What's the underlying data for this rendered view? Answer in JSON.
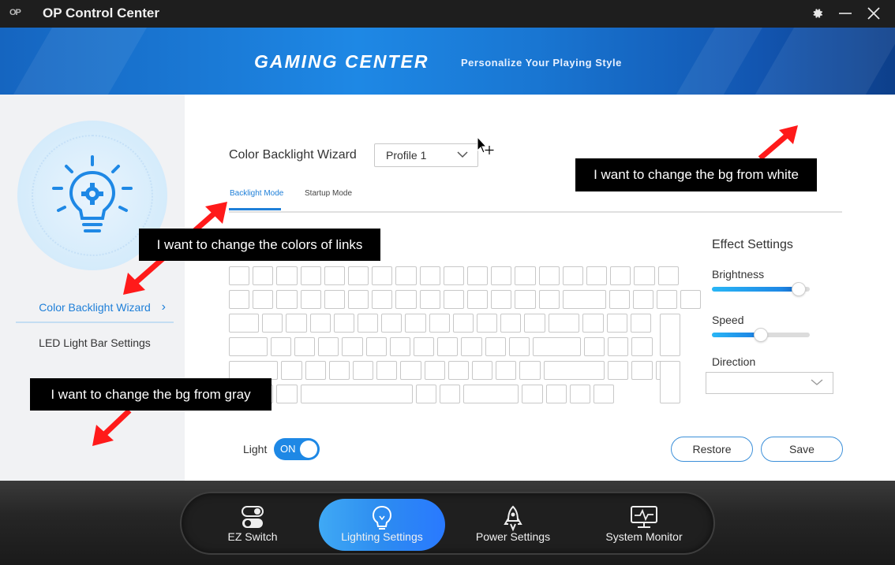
{
  "titlebar": {
    "logo": "OP",
    "title": "OP Control Center"
  },
  "banner": {
    "title": "GAMING CENTER",
    "subtitle": "Personalize Your Playing Style"
  },
  "sidebar": {
    "items": [
      {
        "label": "Color Backlight Wizard",
        "active": true
      },
      {
        "label": "LED Light Bar Settings",
        "active": false
      }
    ]
  },
  "main": {
    "title": "Color Backlight Wizard",
    "profile": {
      "selected": "Profile 1"
    },
    "tabs": [
      {
        "label": "Backlight Mode",
        "active": true
      },
      {
        "label": "Startup Mode",
        "active": false
      }
    ],
    "effect": {
      "title": "Effect Settings",
      "brightness_label": "Brightness",
      "brightness_value": 0.95,
      "speed_label": "Speed",
      "speed_value": 0.5,
      "direction_label": "Direction",
      "direction_value": ""
    },
    "light": {
      "label": "Light",
      "state": "ON"
    },
    "buttons": {
      "restore": "Restore",
      "save": "Save"
    }
  },
  "dock": {
    "items": [
      {
        "label": "EZ Switch",
        "icon": "toggle-switch-icon",
        "active": false
      },
      {
        "label": "Lighting Settings",
        "icon": "lightbulb-icon",
        "active": true
      },
      {
        "label": "Power Settings",
        "icon": "rocket-icon",
        "active": false
      },
      {
        "label": "System Monitor",
        "icon": "monitor-icon",
        "active": false
      }
    ]
  },
  "annotations": [
    "I want to change the bg from white",
    "I want to change the colors of links",
    "I want to change the bg from gray"
  ],
  "colors": {
    "accent": "#1e7fd8",
    "sidebar_bg": "#f1f2f4",
    "annotation_arrow": "#ff0000"
  }
}
